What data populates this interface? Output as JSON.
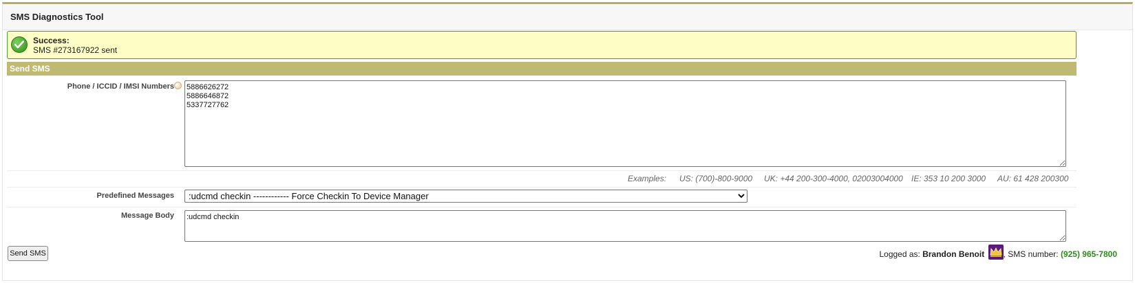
{
  "header": {
    "title": "SMS Diagnostics Tool"
  },
  "alert": {
    "title": "Success:",
    "message": "SMS #273167922 sent"
  },
  "section": {
    "title": "Send SMS"
  },
  "form": {
    "numbers_label": "Phone / ICCID / IMSI Numbers",
    "numbers_value": "5886626272\n5886646872\n5337727762",
    "examples": {
      "label": "Examples:",
      "us": "US: (700)-800-9000",
      "uk": "UK: +44 200-300-4000, 02003004000",
      "ie": "IE: 353 10 200 3000",
      "au": "AU: 61 428 200300"
    },
    "predefined_label": "Predefined Messages",
    "predefined_selected": ":udcmd checkin ------------ Force Checkin To Device Manager",
    "body_label": "Message Body",
    "body_value": ":udcmd checkin",
    "send_button": "Send SMS"
  },
  "footer": {
    "logged_prefix": "Logged as:",
    "user_name": "Brandon Benoit",
    "sms_prefix": ", SMS number:",
    "sms_number": "(925) 965-7800"
  },
  "icons": {
    "success": "check-circle-icon",
    "help": "help-icon",
    "avatar": "crown-avatar-icon"
  },
  "colors": {
    "accent": "#c0b972",
    "success_border": "#4d9b25",
    "alert_bg": "#fdfdc5",
    "phone_green": "#2e8b1e"
  }
}
